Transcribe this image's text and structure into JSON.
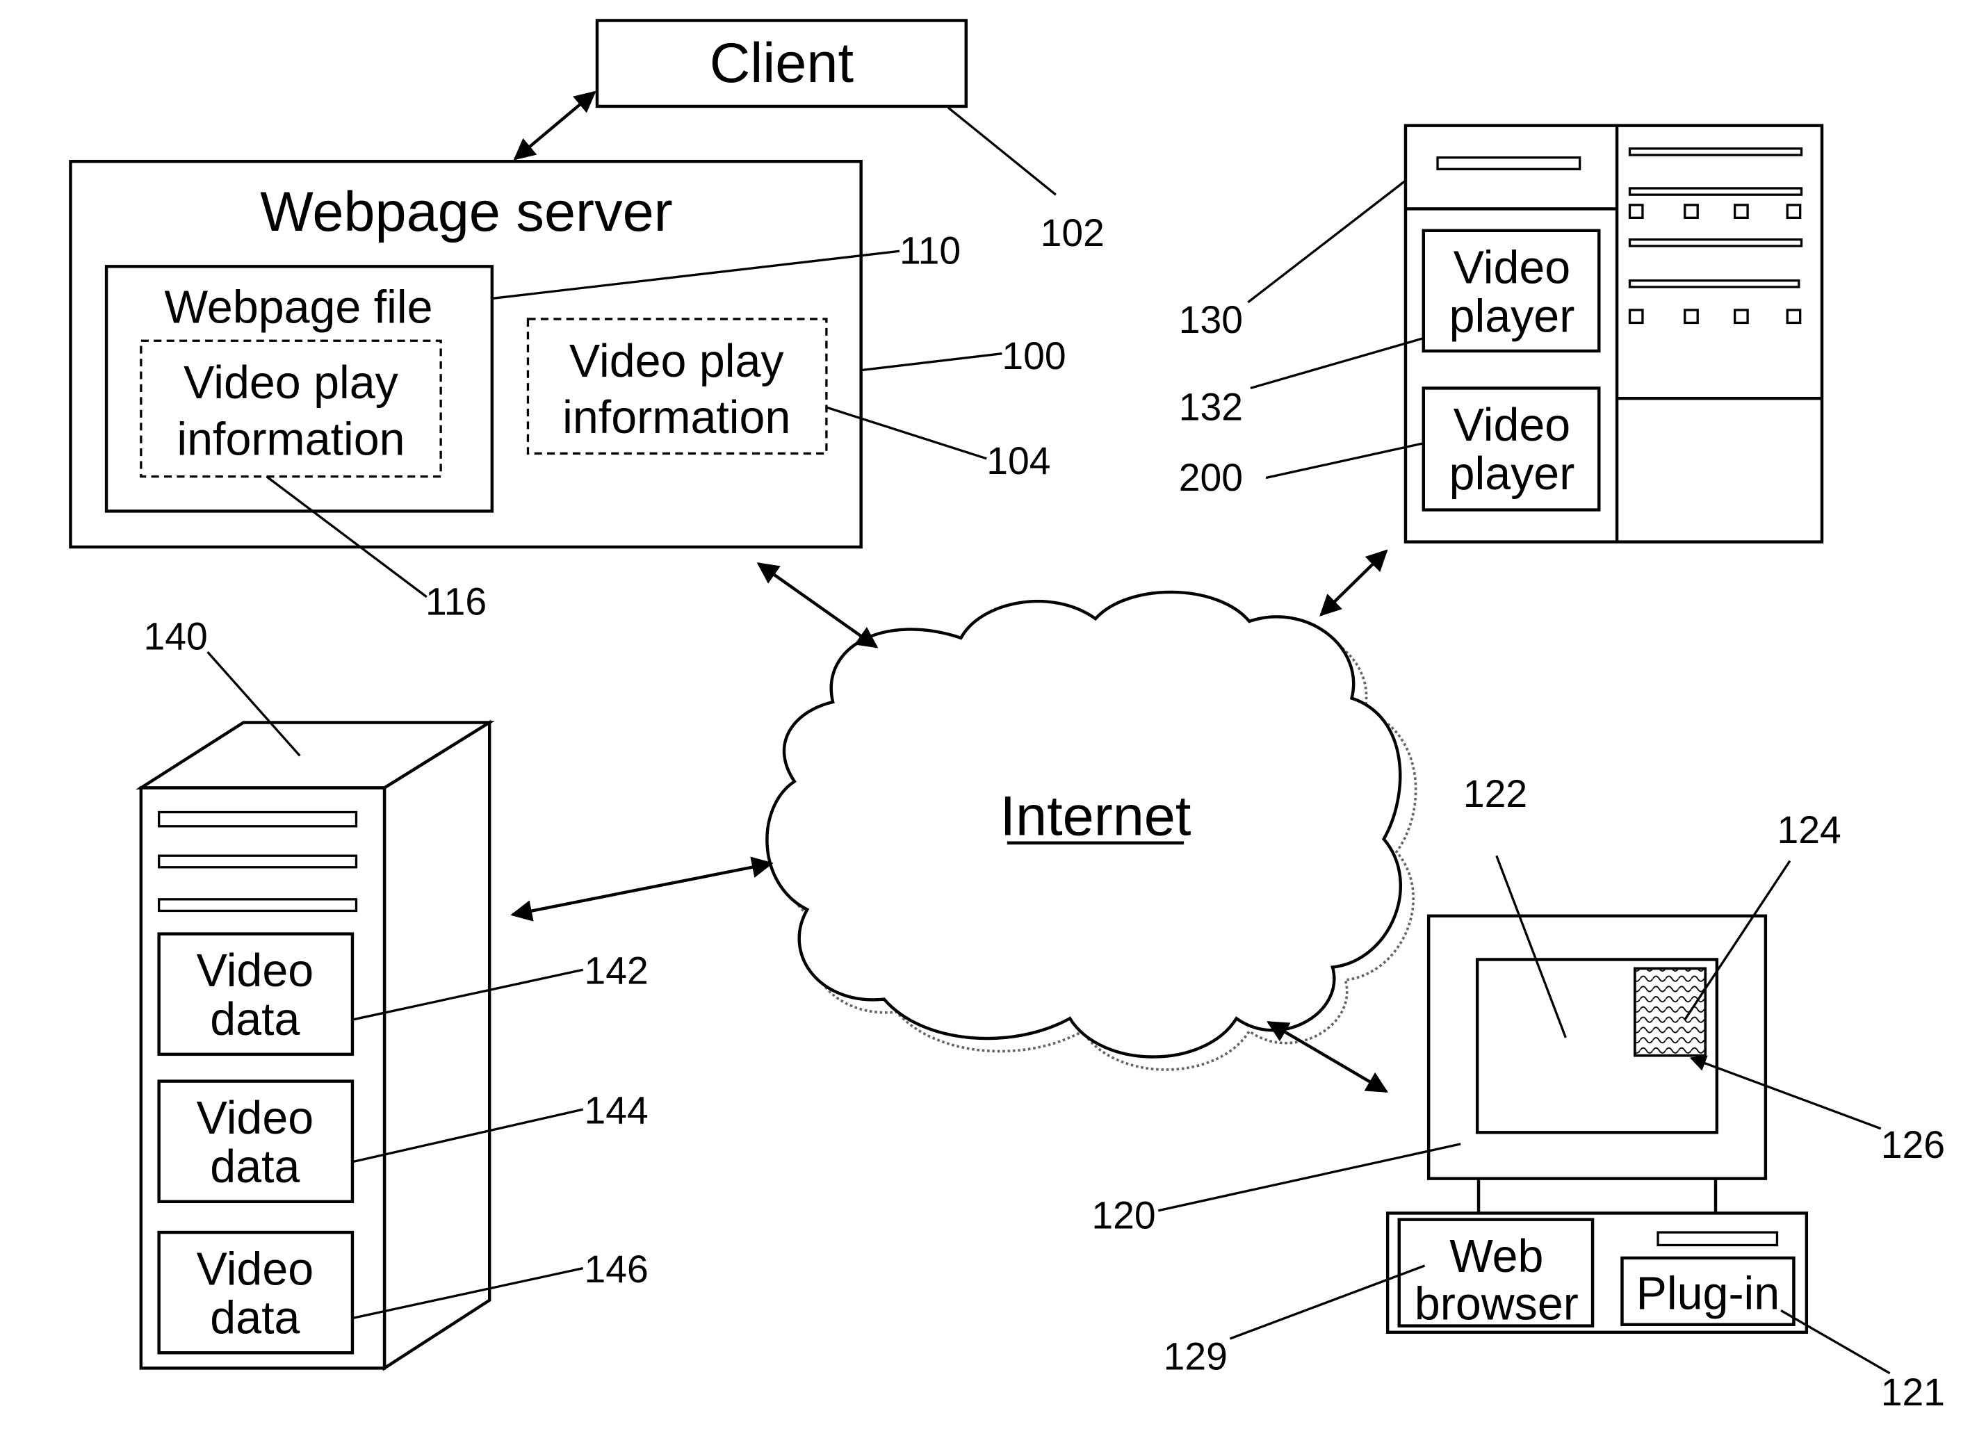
{
  "client": {
    "label": "Client",
    "ref": "102"
  },
  "webpage_server": {
    "title": "Webpage server",
    "ref": "100",
    "webpage_file": {
      "label": "Webpage file",
      "ref": "110"
    },
    "embedded_video_play_info": {
      "line1": "Video play",
      "line2": "information",
      "ref": "116"
    },
    "video_play_info": {
      "line1": "Video play",
      "line2": "information",
      "ref": "104"
    }
  },
  "webpage_display": {
    "ref": "130",
    "players": [
      {
        "line1": "Video",
        "line2": "player",
        "ref": "132"
      },
      {
        "line1": "Video",
        "line2": "player",
        "ref": "200"
      }
    ]
  },
  "internet": {
    "label": "Internet"
  },
  "video_server": {
    "ref": "140",
    "items": [
      {
        "line1": "Video",
        "line2": "data",
        "ref": "142"
      },
      {
        "line1": "Video",
        "line2": "data",
        "ref": "144"
      },
      {
        "line1": "Video",
        "line2": "data",
        "ref": "146"
      }
    ]
  },
  "client_computer": {
    "ref": "120",
    "screen_ref": "122",
    "video_window_ref": "124",
    "pointer_ref": "126",
    "web_browser": {
      "line1": "Web",
      "line2": "browser",
      "ref": "129"
    },
    "plugin": {
      "label": "Plug-in",
      "ref": "121"
    }
  }
}
